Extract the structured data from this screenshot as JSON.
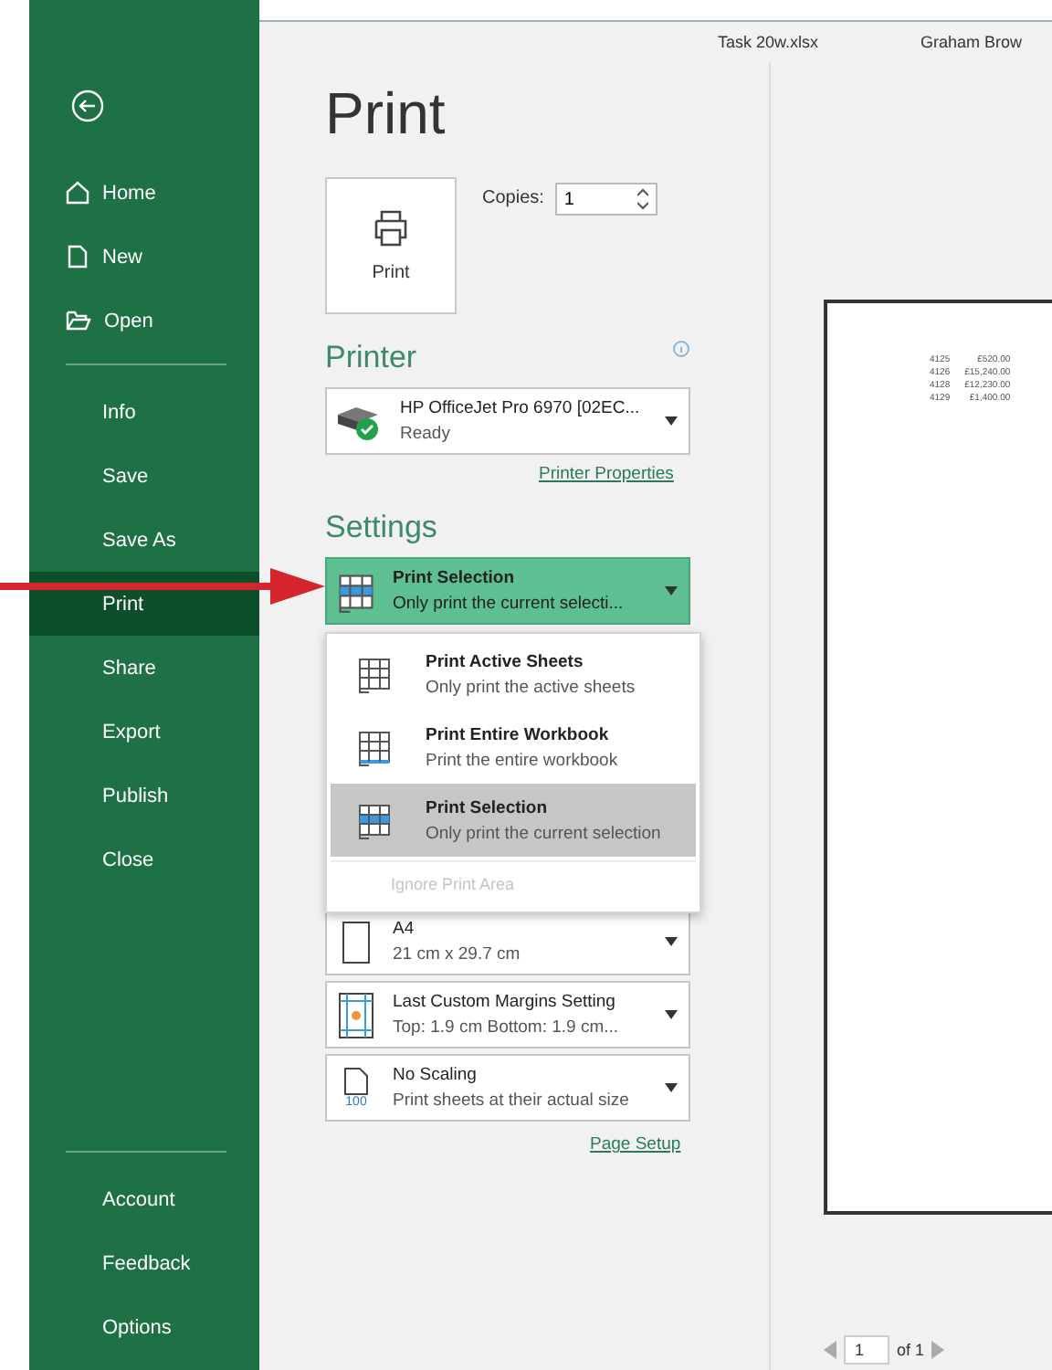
{
  "nav": {
    "top": [
      {
        "kind": "home",
        "label": "Home"
      },
      {
        "kind": "new",
        "label": "New"
      },
      {
        "kind": "open",
        "label": "Open"
      }
    ],
    "middle": [
      {
        "label": "Info",
        "selected": false
      },
      {
        "label": "Save",
        "selected": false
      },
      {
        "label": "Save As",
        "selected": false
      },
      {
        "label": "Print",
        "selected": true
      },
      {
        "label": "Share",
        "selected": false
      },
      {
        "label": "Export",
        "selected": false
      },
      {
        "label": "Publish",
        "selected": false
      },
      {
        "label": "Close",
        "selected": false
      }
    ],
    "bottom": [
      {
        "label": "Account"
      },
      {
        "label": "Feedback"
      },
      {
        "label": "Options"
      }
    ]
  },
  "header": {
    "file_name": "Task 20w.xlsx",
    "user": "Graham Brow"
  },
  "title": "Print",
  "print_button": {
    "label": "Print"
  },
  "copies": {
    "label": "Copies:",
    "value": "1"
  },
  "printer": {
    "heading": "Printer",
    "name": "HP OfficeJet Pro 6970 [02EC...",
    "status": "Ready",
    "link": "Printer Properties"
  },
  "settings": {
    "heading": "Settings",
    "current": {
      "kind": "selection",
      "title": "Print Selection",
      "subtitle": "Only print the current selecti...",
      "expanded": true
    },
    "menu": {
      "options": [
        {
          "kind": "active",
          "title": "Print Active Sheets",
          "subtitle": "Only print the active sheets",
          "selected": false
        },
        {
          "kind": "workbook",
          "title": "Print Entire Workbook",
          "subtitle": "Print the entire workbook",
          "selected": false
        },
        {
          "kind": "selection",
          "title": "Print Selection",
          "subtitle": "Only print the current selection",
          "selected": true
        }
      ],
      "footer": {
        "label": "Ignore Print Area",
        "disabled": true
      }
    },
    "items": [
      {
        "kind": "paper",
        "title": "A4",
        "subtitle": "21 cm x 29.7 cm"
      },
      {
        "kind": "margins",
        "title": "Last Custom Margins Setting",
        "subtitle": "Top: 1.9 cm Bottom: 1.9 cm..."
      },
      {
        "kind": "scaling",
        "title": "No Scaling",
        "subtitle": "Print sheets at their actual size",
        "badge": "100"
      }
    ],
    "link": "Page Setup"
  },
  "preview": {
    "rows": [
      [
        "4125",
        "£520.00"
      ],
      [
        "4126",
        "£15,240.00"
      ],
      [
        "4128",
        "£12,230.00"
      ],
      [
        "4129",
        "£1,400.00"
      ]
    ],
    "page": "1",
    "page_count": "of 1"
  }
}
